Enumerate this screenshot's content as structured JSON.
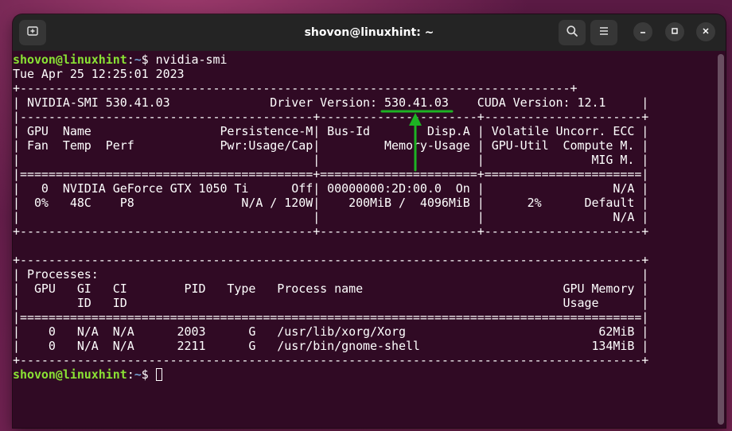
{
  "window": {
    "title": "shovon@linuxhint: ~",
    "icons": [
      "new-tab-icon",
      "search-icon",
      "menu-icon",
      "minimize-icon",
      "maximize-icon",
      "close-icon"
    ]
  },
  "terminal": {
    "prompt_user_host": "shovon@linuxhint",
    "prompt_sep": ":",
    "prompt_path": "~",
    "prompt_symbol": "$ ",
    "command": "nvidia-smi",
    "lines": [
      "Tue Apr 25 12:25:01 2023",
      "+-----------------------------------------------------------------------------+",
      "| NVIDIA-SMI 530.41.03              Driver Version: 530.41.03    CUDA Version: 12.1     |",
      "|-----------------------------------------+----------------------+----------------------+",
      "| GPU  Name                  Persistence-M| Bus-Id        Disp.A | Volatile Uncorr. ECC |",
      "| Fan  Temp  Perf            Pwr:Usage/Cap|         Memory-Usage | GPU-Util  Compute M. |",
      "|                                         |                      |               MIG M. |",
      "|=========================================+======================+======================|",
      "|   0  NVIDIA GeForce GTX 1050 Ti      Off| 00000000:2D:00.0  On |                  N/A |",
      "|  0%   48C    P8               N/A / 120W|    200MiB /  4096MiB |      2%      Default |",
      "|                                         |                      |                  N/A |",
      "+-----------------------------------------+----------------------+----------------------+",
      "",
      "+---------------------------------------------------------------------------------------+",
      "| Processes:                                                                            |",
      "|  GPU   GI   CI        PID   Type   Process name                            GPU Memory |",
      "|        ID   ID                                                             Usage      |",
      "|=======================================================================================|",
      "|    0   N/A  N/A      2003      G   /usr/lib/xorg/Xorg                           62MiB |",
      "|    0   N/A  N/A      2211      G   /usr/bin/gnome-shell                        134MiB |",
      "+---------------------------------------------------------------------------------------+"
    ]
  },
  "annotation": {
    "color": "#1db323",
    "highlighted_value": "530.41.03"
  }
}
